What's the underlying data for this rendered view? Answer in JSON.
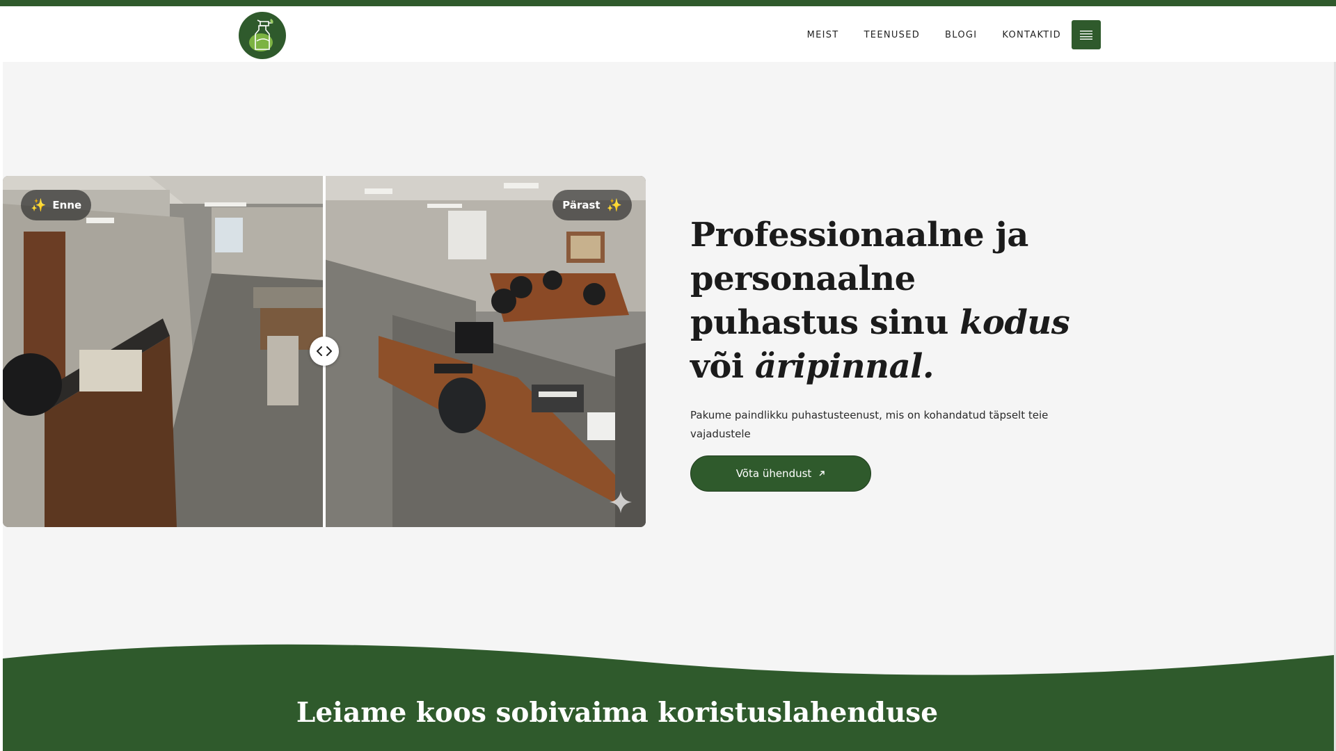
{
  "brand": {
    "accent": "#2f5a2c",
    "logo_icon": "spray-bottle-icon"
  },
  "nav": {
    "items": [
      {
        "label": "MEIST"
      },
      {
        "label": "TEENUSED"
      },
      {
        "label": "BLOGI"
      },
      {
        "label": "KONTAKTID"
      }
    ],
    "menu_icon": "hamburger-icon"
  },
  "hero": {
    "compare": {
      "before_label": "Enne",
      "after_label": "Pärast",
      "sparkle": "✨",
      "handle_icon": "chevrons-left-right-icon"
    },
    "title": {
      "part1": "Professionaalne ja personaalne puhastus sinu ",
      "em1": "kodus",
      "part2": " või ",
      "em2": "äripinnal."
    },
    "lead": "Pakume paindlikku puhastusteenust, mis on kohandatud täpselt teie vajadustele",
    "cta_label": "Võta ühendust",
    "cta_icon": "arrow-up-right-icon"
  },
  "section2": {
    "title": "Leiame koos sobivaima koristuslahenduse"
  }
}
